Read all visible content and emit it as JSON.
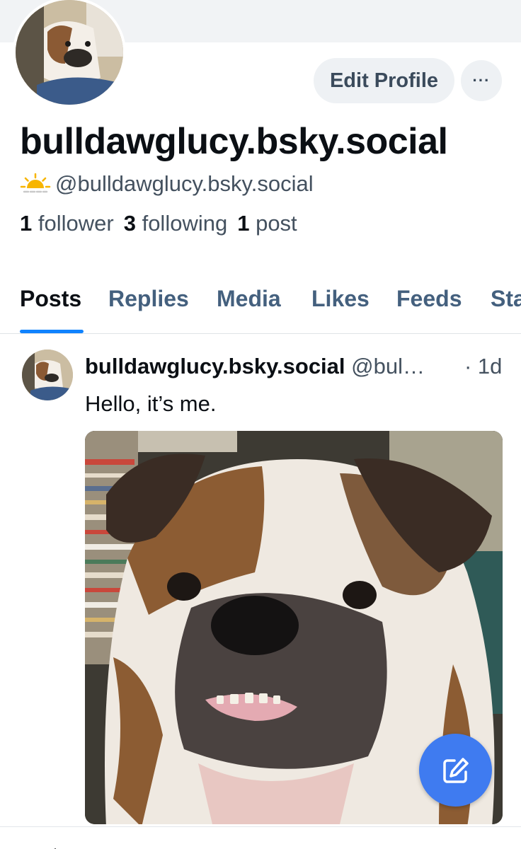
{
  "profile": {
    "display_name": "bulldawglucy.bsky.social",
    "handle": "@bulldawglucy.bsky.social",
    "status_icon": "sun-icon",
    "stats": {
      "followers_count": "1",
      "followers_label": "follower",
      "following_count": "3",
      "following_label": "following",
      "posts_count": "1",
      "posts_label": "post"
    }
  },
  "actions": {
    "edit_profile_label": "Edit Profile",
    "more_label": "···"
  },
  "tabs": [
    {
      "label": "Posts",
      "active": true
    },
    {
      "label": "Replies"
    },
    {
      "label": "Media"
    },
    {
      "label": "Likes"
    },
    {
      "label": "Feeds"
    },
    {
      "label": "Sta"
    }
  ],
  "post": {
    "author": "bulldawglucy.bsky.social",
    "handle": "@bul…",
    "time": "· 1d",
    "text": "Hello, it’s me."
  },
  "colors": {
    "accent": "#1083fe",
    "fab": "#3f7bf0",
    "muted_text": "#44515f",
    "tab_inactive": "#44607e"
  }
}
